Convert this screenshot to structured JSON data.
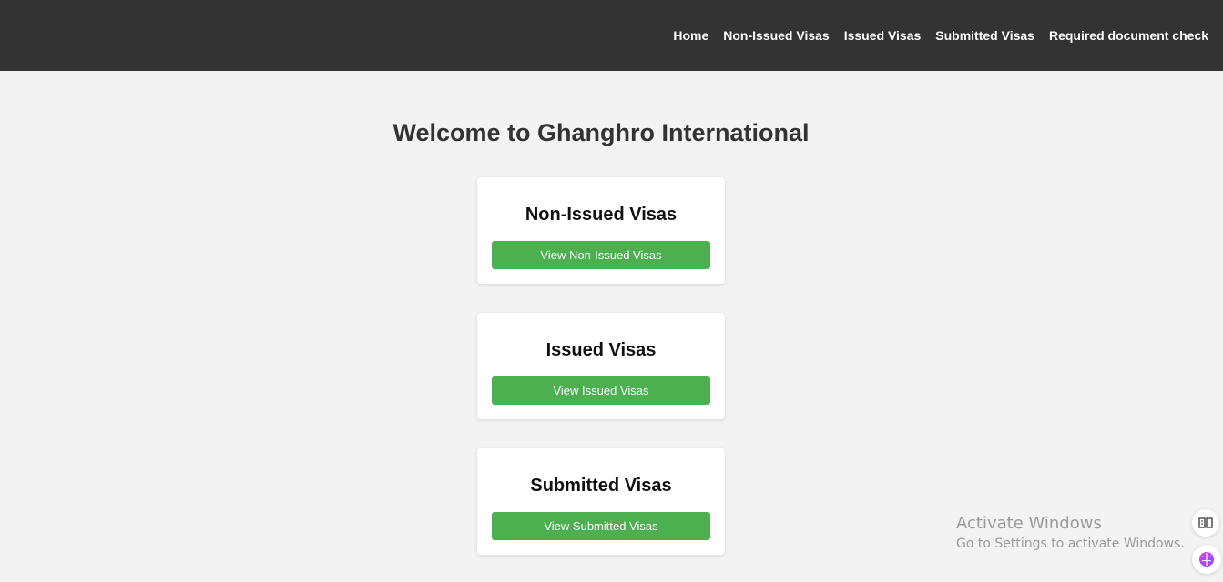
{
  "nav": {
    "items": [
      {
        "label": "Home"
      },
      {
        "label": "Non-Issued Visas"
      },
      {
        "label": "Issued Visas"
      },
      {
        "label": "Submitted Visas"
      },
      {
        "label": "Required document check"
      }
    ]
  },
  "main": {
    "title": "Welcome to Ghanghro International",
    "cards": [
      {
        "title": "Non-Issued Visas",
        "button": "View Non-Issued Visas"
      },
      {
        "title": "Issued Visas",
        "button": "View Issued Visas"
      },
      {
        "title": "Submitted Visas",
        "button": "View Submitted Visas"
      }
    ]
  },
  "watermark": {
    "line1": "Activate Windows",
    "line2": "Go to Settings to activate Windows."
  },
  "icons": {
    "reader": "reader-icon",
    "brain": "brain-icon"
  },
  "colors": {
    "nav_bg": "#333333",
    "page_bg": "#f3f3f3",
    "button_bg": "#4caf50",
    "title_text": "#333333"
  }
}
